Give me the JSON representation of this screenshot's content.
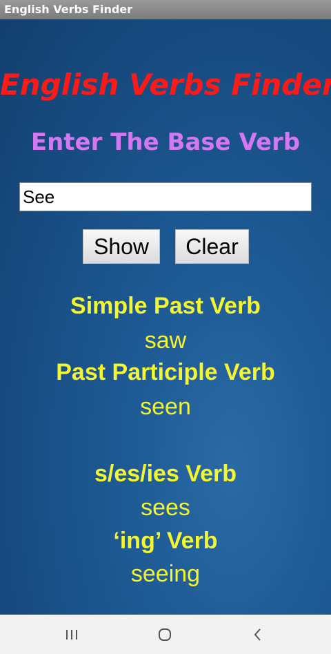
{
  "window": {
    "title": "English Verbs Finder"
  },
  "app": {
    "title": "English Verbs Finder",
    "prompt": "Enter The Base Verb",
    "input_value": "See",
    "buttons": {
      "show": "Show",
      "clear": "Clear"
    }
  },
  "results": {
    "simple_past_label": "Simple Past Verb",
    "simple_past_value": "saw",
    "past_participle_label": "Past Participle Verb",
    "past_participle_value": "seen",
    "s_form_label": "s/es/ies Verb",
    "s_form_value": "sees",
    "ing_label": "‘ing’ Verb",
    "ing_value": "seeing"
  },
  "navbar": {
    "icons": [
      "recents-icon",
      "home-icon",
      "back-icon"
    ]
  },
  "colors": {
    "background": "#1d5993",
    "title": "#ff1a1a",
    "prompt": "#d478f2",
    "results": "#f5f530"
  }
}
